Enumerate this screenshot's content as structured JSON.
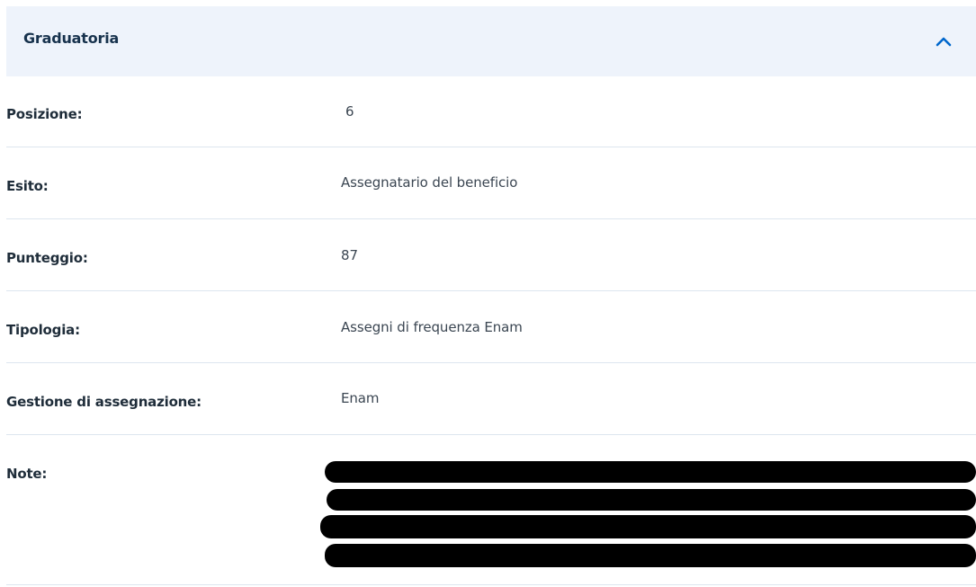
{
  "section": {
    "title": "Graduatoria",
    "expanded": true,
    "toggle_icon": "chevron-up-icon"
  },
  "rows": [
    {
      "label": "Posizione:",
      "value": "6"
    },
    {
      "label": "Esito:",
      "value": "Assegnatario del beneficio"
    },
    {
      "label": "Punteggio:",
      "value": "87"
    },
    {
      "label": "Tipologia:",
      "value": "Assegni di frequenza Enam"
    },
    {
      "label": "Gestione di assegnazione:",
      "value": "Enam"
    },
    {
      "label": "Note:",
      "value": ""
    }
  ],
  "colors": {
    "accent": "#0066cc",
    "header_bg": "#eef3fb",
    "divider": "#dde6ef"
  }
}
